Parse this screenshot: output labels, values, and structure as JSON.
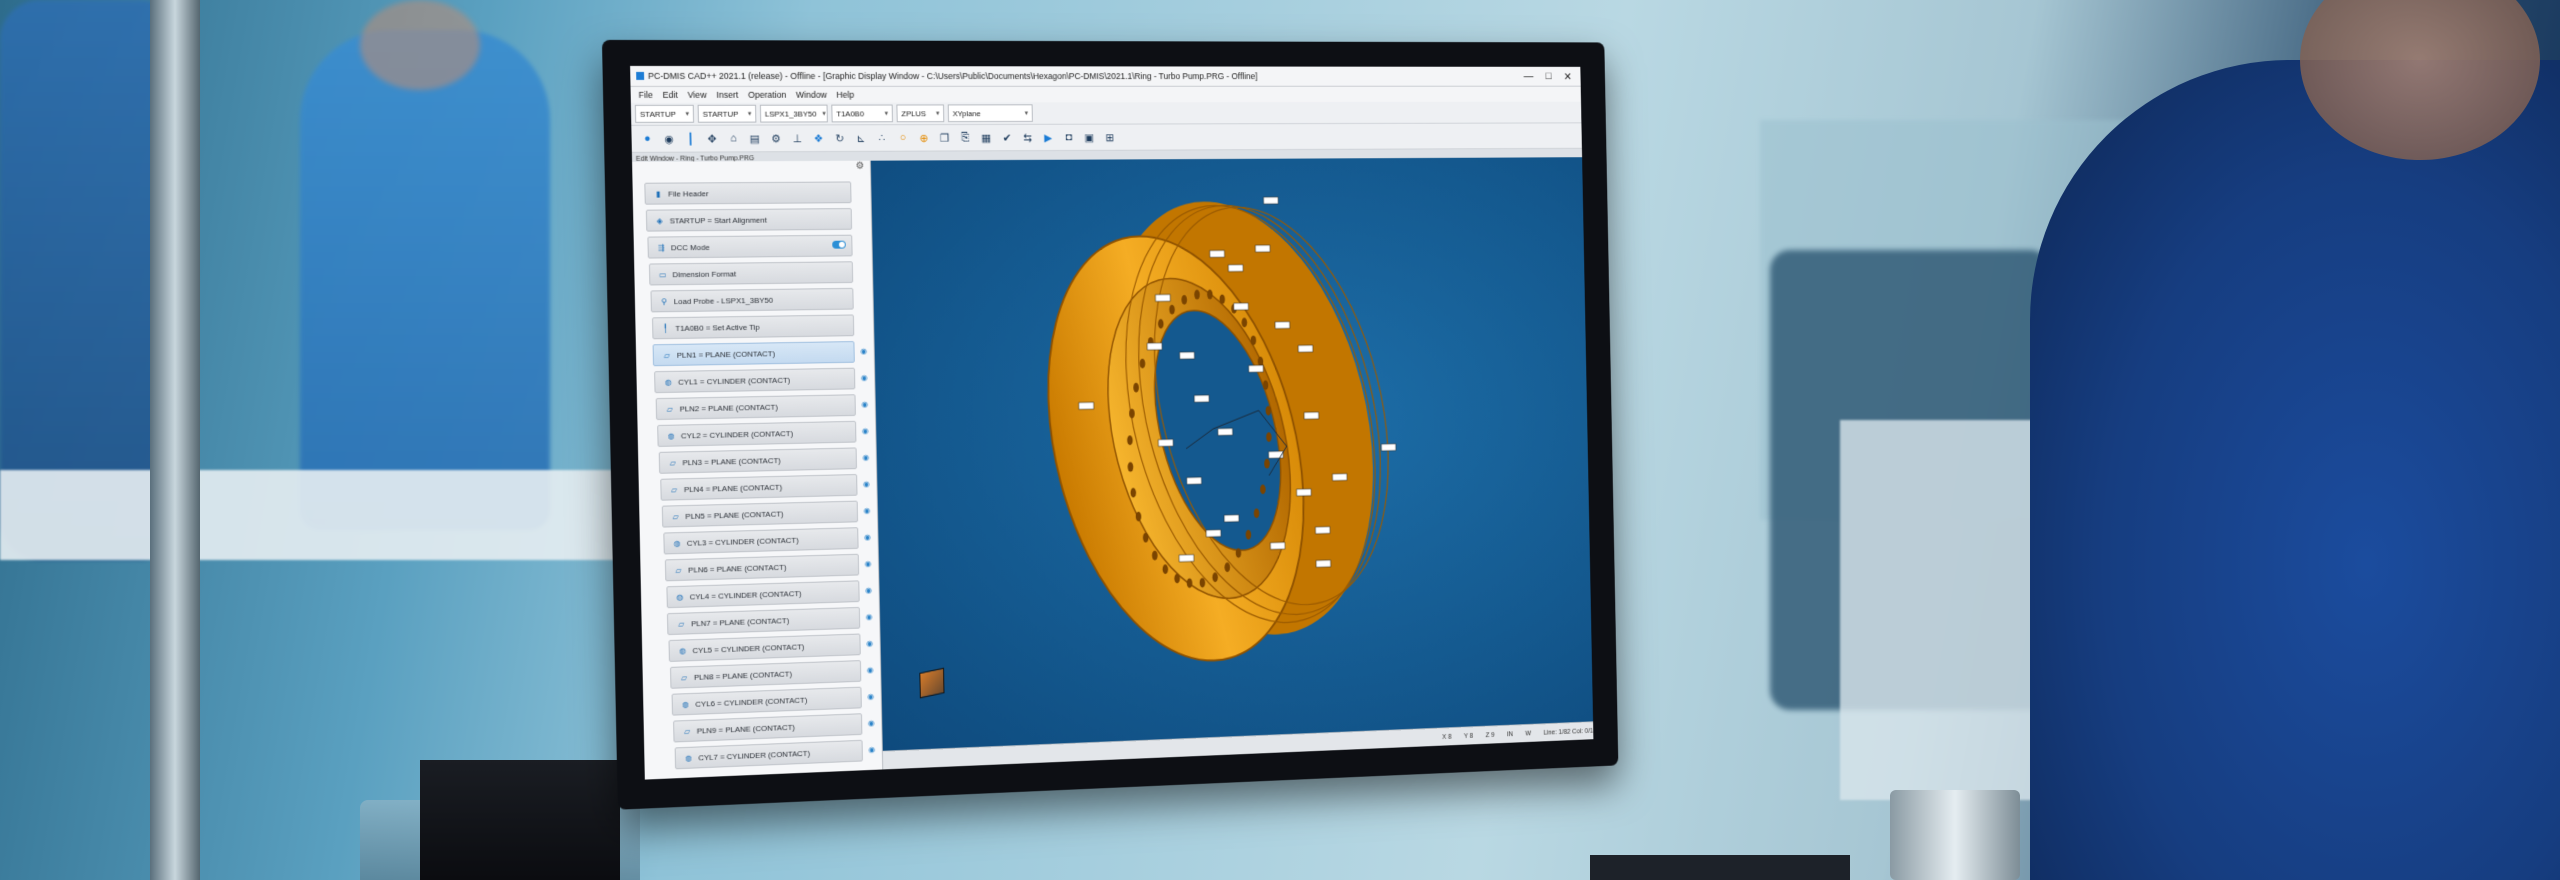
{
  "app": {
    "title": "PC-DMIS CAD++ 2021.1 (release) - Offline - [Graphic Display Window - C:\\Users\\Public\\Documents\\Hexagon\\PC-DMIS\\2021.1\\Ring - Turbo Pump.PRG - Offline]",
    "window_controls": [
      "—",
      "□",
      "✕"
    ],
    "menu": [
      "File",
      "Edit",
      "View",
      "Insert",
      "Operation",
      "Window",
      "Help"
    ],
    "dropdowns": [
      "STARTUP",
      "STARTUP",
      "LSPX1_3BY50",
      "T1A0B0",
      "ZPLUS",
      "XYplane"
    ],
    "subwindow_title": "Edit Window - Ring - Turbo Pump.PRG"
  },
  "toolbar_icons": [
    "probe-icon",
    "camera-view-icon",
    "cursor-icon",
    "move-icon",
    "probe-tip-icon",
    "comment-icon",
    "settings-icon",
    "measure-icon",
    "graphics-mode-icon",
    "rotate-icon",
    "axes-icon",
    "point-icon",
    "circle-icon",
    "target-icon",
    "copy-icon",
    "paste-icon",
    "table-icon",
    "check-icon",
    "alignment-icon",
    "play-icon",
    "camera-icon",
    "report-icon",
    "grid-icon"
  ],
  "edit_window": {
    "items": [
      {
        "label": "File Header",
        "icon": "document-icon",
        "selected": false,
        "toggle": false
      },
      {
        "label": "STARTUP = Start Alignment",
        "icon": "alignment-icon",
        "selected": false,
        "toggle": false
      },
      {
        "label": "DCC Mode",
        "icon": "dcc-icon",
        "selected": false,
        "toggle": true
      },
      {
        "label": "Dimension Format",
        "icon": "format-icon",
        "selected": false,
        "toggle": false
      },
      {
        "label": "Load Probe - LSPX1_3BY50",
        "icon": "probe-icon",
        "selected": false,
        "toggle": false
      },
      {
        "label": "T1A0B0 = Set Active Tip",
        "icon": "tip-icon",
        "selected": false,
        "toggle": false
      },
      {
        "label": "PLN1 = PLANE (CONTACT)",
        "icon": "plane-icon",
        "selected": true,
        "toggle": false
      },
      {
        "label": "CYL1 = CYLINDER (CONTACT)",
        "icon": "cylinder-icon",
        "selected": false,
        "toggle": false
      },
      {
        "label": "PLN2 = PLANE (CONTACT)",
        "icon": "plane-icon",
        "selected": false,
        "toggle": false
      },
      {
        "label": "CYL2 = CYLINDER (CONTACT)",
        "icon": "cylinder-icon",
        "selected": false,
        "toggle": false
      },
      {
        "label": "PLN3 = PLANE (CONTACT)",
        "icon": "plane-icon",
        "selected": false,
        "toggle": false
      },
      {
        "label": "PLN4 = PLANE (CONTACT)",
        "icon": "plane-icon",
        "selected": false,
        "toggle": false
      },
      {
        "label": "PLN5 = PLANE (CONTACT)",
        "icon": "plane-icon",
        "selected": false,
        "toggle": false
      },
      {
        "label": "CYL3 = CYLINDER (CONTACT)",
        "icon": "cylinder-icon",
        "selected": false,
        "toggle": false
      },
      {
        "label": "PLN6 = PLANE (CONTACT)",
        "icon": "plane-icon",
        "selected": false,
        "toggle": false
      },
      {
        "label": "CYL4 = CYLINDER (CONTACT)",
        "icon": "cylinder-icon",
        "selected": false,
        "toggle": false
      },
      {
        "label": "PLN7 = PLANE (CONTACT)",
        "icon": "plane-icon",
        "selected": false,
        "toggle": false
      },
      {
        "label": "CYL5 = CYLINDER (CONTACT)",
        "icon": "cylinder-icon",
        "selected": false,
        "toggle": false
      },
      {
        "label": "PLN8 = PLANE (CONTACT)",
        "icon": "plane-icon",
        "selected": false,
        "toggle": false
      },
      {
        "label": "CYL6 = CYLINDER (CONTACT)",
        "icon": "cylinder-icon",
        "selected": false,
        "toggle": false
      },
      {
        "label": "PLN9 = PLANE (CONTACT)",
        "icon": "plane-icon",
        "selected": false,
        "toggle": false
      },
      {
        "label": "CYL7 = CYLINDER (CONTACT)",
        "icon": "cylinder-icon",
        "selected": false,
        "toggle": false
      }
    ]
  },
  "status_bar": {
    "values": [
      "X 8",
      "Y 8",
      "Z 9",
      "IN",
      "W",
      "Line: 1/82  Col: 0/1"
    ]
  },
  "colors": {
    "viewport": "#14598f",
    "part": "#f0a41c",
    "part_shadow": "#b56a00",
    "accent": "#2b8fd6"
  }
}
